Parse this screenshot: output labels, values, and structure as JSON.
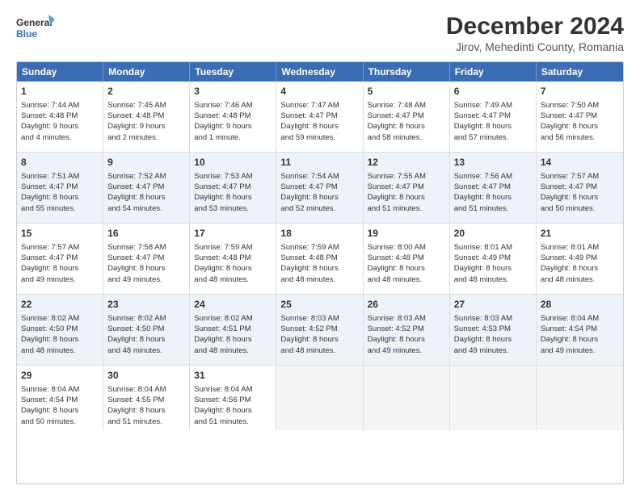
{
  "header": {
    "logo_line1": "General",
    "logo_line2": "Blue",
    "title": "December 2024",
    "subtitle": "Jirov, Mehedinti County, Romania"
  },
  "calendar": {
    "days_of_week": [
      "Sunday",
      "Monday",
      "Tuesday",
      "Wednesday",
      "Thursday",
      "Friday",
      "Saturday"
    ],
    "weeks": [
      [
        {
          "day": "",
          "content": ""
        },
        {
          "day": "2",
          "content": "Sunrise: 7:45 AM\nSunset: 4:48 PM\nDaylight: 9 hours\nand 2 minutes."
        },
        {
          "day": "3",
          "content": "Sunrise: 7:46 AM\nSunset: 4:48 PM\nDaylight: 9 hours\nand 1 minute."
        },
        {
          "day": "4",
          "content": "Sunrise: 7:47 AM\nSunset: 4:47 PM\nDaylight: 8 hours\nand 59 minutes."
        },
        {
          "day": "5",
          "content": "Sunrise: 7:48 AM\nSunset: 4:47 PM\nDaylight: 8 hours\nand 58 minutes."
        },
        {
          "day": "6",
          "content": "Sunrise: 7:49 AM\nSunset: 4:47 PM\nDaylight: 8 hours\nand 57 minutes."
        },
        {
          "day": "7",
          "content": "Sunrise: 7:50 AM\nSunset: 4:47 PM\nDaylight: 8 hours\nand 56 minutes."
        }
      ],
      [
        {
          "day": "1",
          "content": "Sunrise: 7:44 AM\nSunset: 4:48 PM\nDaylight: 9 hours\nand 4 minutes."
        },
        {
          "day": "",
          "content": ""
        },
        {
          "day": "",
          "content": ""
        },
        {
          "day": "",
          "content": ""
        },
        {
          "day": "",
          "content": ""
        },
        {
          "day": "",
          "content": ""
        },
        {
          "day": "",
          "content": ""
        }
      ],
      [
        {
          "day": "8",
          "content": "Sunrise: 7:51 AM\nSunset: 4:47 PM\nDaylight: 8 hours\nand 55 minutes."
        },
        {
          "day": "9",
          "content": "Sunrise: 7:52 AM\nSunset: 4:47 PM\nDaylight: 8 hours\nand 54 minutes."
        },
        {
          "day": "10",
          "content": "Sunrise: 7:53 AM\nSunset: 4:47 PM\nDaylight: 8 hours\nand 53 minutes."
        },
        {
          "day": "11",
          "content": "Sunrise: 7:54 AM\nSunset: 4:47 PM\nDaylight: 8 hours\nand 52 minutes."
        },
        {
          "day": "12",
          "content": "Sunrise: 7:55 AM\nSunset: 4:47 PM\nDaylight: 8 hours\nand 51 minutes."
        },
        {
          "day": "13",
          "content": "Sunrise: 7:56 AM\nSunset: 4:47 PM\nDaylight: 8 hours\nand 51 minutes."
        },
        {
          "day": "14",
          "content": "Sunrise: 7:57 AM\nSunset: 4:47 PM\nDaylight: 8 hours\nand 50 minutes."
        }
      ],
      [
        {
          "day": "15",
          "content": "Sunrise: 7:57 AM\nSunset: 4:47 PM\nDaylight: 8 hours\nand 49 minutes."
        },
        {
          "day": "16",
          "content": "Sunrise: 7:58 AM\nSunset: 4:47 PM\nDaylight: 8 hours\nand 49 minutes."
        },
        {
          "day": "17",
          "content": "Sunrise: 7:59 AM\nSunset: 4:48 PM\nDaylight: 8 hours\nand 48 minutes."
        },
        {
          "day": "18",
          "content": "Sunrise: 7:59 AM\nSunset: 4:48 PM\nDaylight: 8 hours\nand 48 minutes."
        },
        {
          "day": "19",
          "content": "Sunrise: 8:00 AM\nSunset: 4:48 PM\nDaylight: 8 hours\nand 48 minutes."
        },
        {
          "day": "20",
          "content": "Sunrise: 8:01 AM\nSunset: 4:49 PM\nDaylight: 8 hours\nand 48 minutes."
        },
        {
          "day": "21",
          "content": "Sunrise: 8:01 AM\nSunset: 4:49 PM\nDaylight: 8 hours\nand 48 minutes."
        }
      ],
      [
        {
          "day": "22",
          "content": "Sunrise: 8:02 AM\nSunset: 4:50 PM\nDaylight: 8 hours\nand 48 minutes."
        },
        {
          "day": "23",
          "content": "Sunrise: 8:02 AM\nSunset: 4:50 PM\nDaylight: 8 hours\nand 48 minutes."
        },
        {
          "day": "24",
          "content": "Sunrise: 8:02 AM\nSunset: 4:51 PM\nDaylight: 8 hours\nand 48 minutes."
        },
        {
          "day": "25",
          "content": "Sunrise: 8:03 AM\nSunset: 4:52 PM\nDaylight: 8 hours\nand 48 minutes."
        },
        {
          "day": "26",
          "content": "Sunrise: 8:03 AM\nSunset: 4:52 PM\nDaylight: 8 hours\nand 49 minutes."
        },
        {
          "day": "27",
          "content": "Sunrise: 8:03 AM\nSunset: 4:53 PM\nDaylight: 8 hours\nand 49 minutes."
        },
        {
          "day": "28",
          "content": "Sunrise: 8:04 AM\nSunset: 4:54 PM\nDaylight: 8 hours\nand 49 minutes."
        }
      ],
      [
        {
          "day": "29",
          "content": "Sunrise: 8:04 AM\nSunset: 4:54 PM\nDaylight: 8 hours\nand 50 minutes."
        },
        {
          "day": "30",
          "content": "Sunrise: 8:04 AM\nSunset: 4:55 PM\nDaylight: 8 hours\nand 51 minutes."
        },
        {
          "day": "31",
          "content": "Sunrise: 8:04 AM\nSunset: 4:56 PM\nDaylight: 8 hours\nand 51 minutes."
        },
        {
          "day": "",
          "content": ""
        },
        {
          "day": "",
          "content": ""
        },
        {
          "day": "",
          "content": ""
        },
        {
          "day": "",
          "content": ""
        }
      ]
    ]
  }
}
